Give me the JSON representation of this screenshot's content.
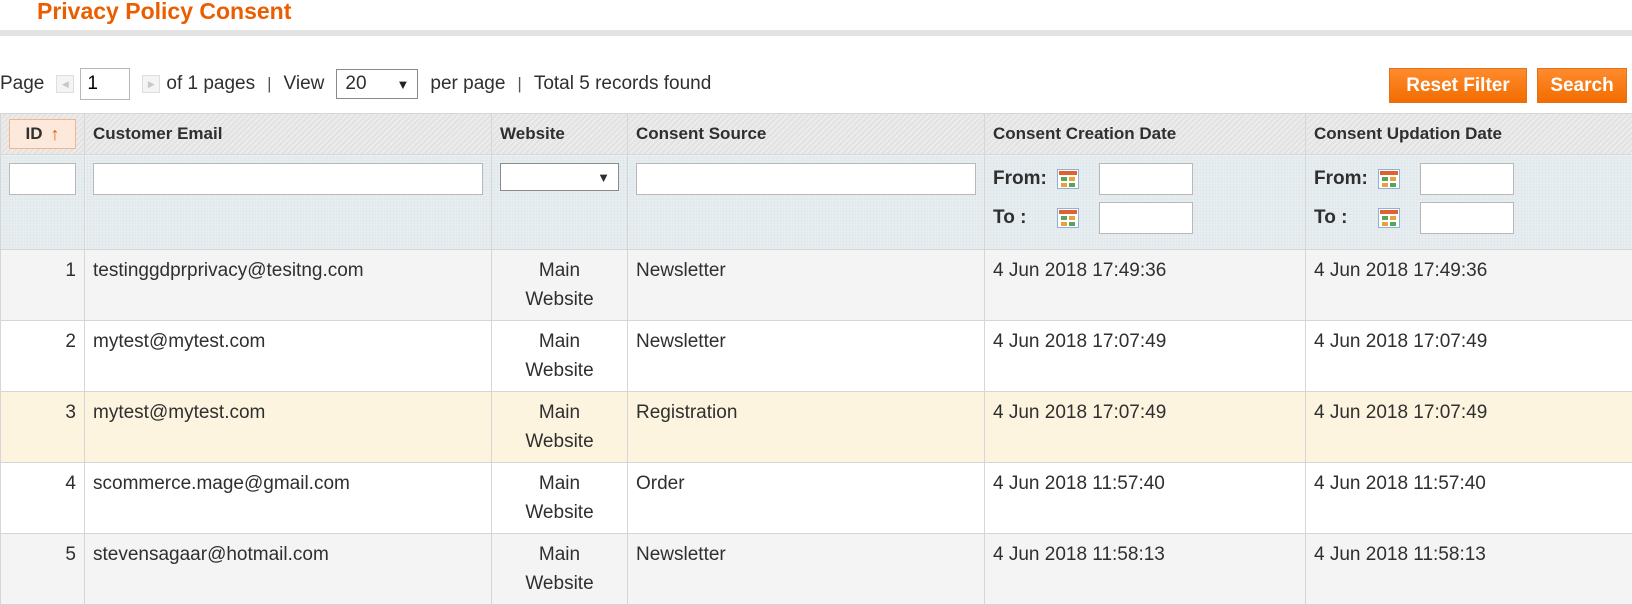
{
  "page": {
    "title": "Privacy Policy Consent"
  },
  "pager": {
    "page_label": "Page",
    "current_page": "1",
    "of_pages": "of 1 pages",
    "separator": "|",
    "view_label": "View",
    "per_page_value": "20",
    "per_page_label": "per page",
    "total": "Total 5 records found"
  },
  "buttons": {
    "reset_filter": "Reset Filter",
    "search": "Search"
  },
  "columns": {
    "id": "ID",
    "email": "Customer Email",
    "website": "Website",
    "source": "Consent Source",
    "created": "Consent Creation Date",
    "updated": "Consent Updation Date"
  },
  "filters": {
    "from_label": "From:",
    "to_label": "To :"
  },
  "rows": [
    {
      "id": "1",
      "email": "testinggdprprivacy@tesitng.com",
      "website_1": "Main",
      "website_2": "Website",
      "source": "Newsletter",
      "created": "4 Jun 2018 17:49:36",
      "updated": "4 Jun 2018 17:49:36"
    },
    {
      "id": "2",
      "email": "mytest@mytest.com",
      "website_1": "Main",
      "website_2": "Website",
      "source": "Newsletter",
      "created": "4 Jun 2018 17:07:49",
      "updated": "4 Jun 2018 17:07:49"
    },
    {
      "id": "3",
      "email": "mytest@mytest.com",
      "website_1": "Main",
      "website_2": "Website",
      "source": "Registration",
      "created": "4 Jun 2018 17:07:49",
      "updated": "4 Jun 2018 17:07:49"
    },
    {
      "id": "4",
      "email": "scommerce.mage@gmail.com",
      "website_1": "Main",
      "website_2": "Website",
      "source": "Order",
      "created": "4 Jun 2018 11:57:40",
      "updated": "4 Jun 2018 11:57:40"
    },
    {
      "id": "5",
      "email": "stevensagaar@hotmail.com",
      "website_1": "Main",
      "website_2": "Website",
      "source": "Newsletter",
      "created": "4 Jun 2018 11:58:13",
      "updated": "4 Jun 2018 11:58:13"
    }
  ],
  "colors": {
    "accent": "#eb5e00",
    "button": "#f7790f",
    "highlight_row": "#fcf4de"
  },
  "icons": {
    "prev": "prev-page-icon",
    "next": "next-page-icon",
    "calendar": "calendar-icon",
    "sort": "sort-asc-icon"
  }
}
